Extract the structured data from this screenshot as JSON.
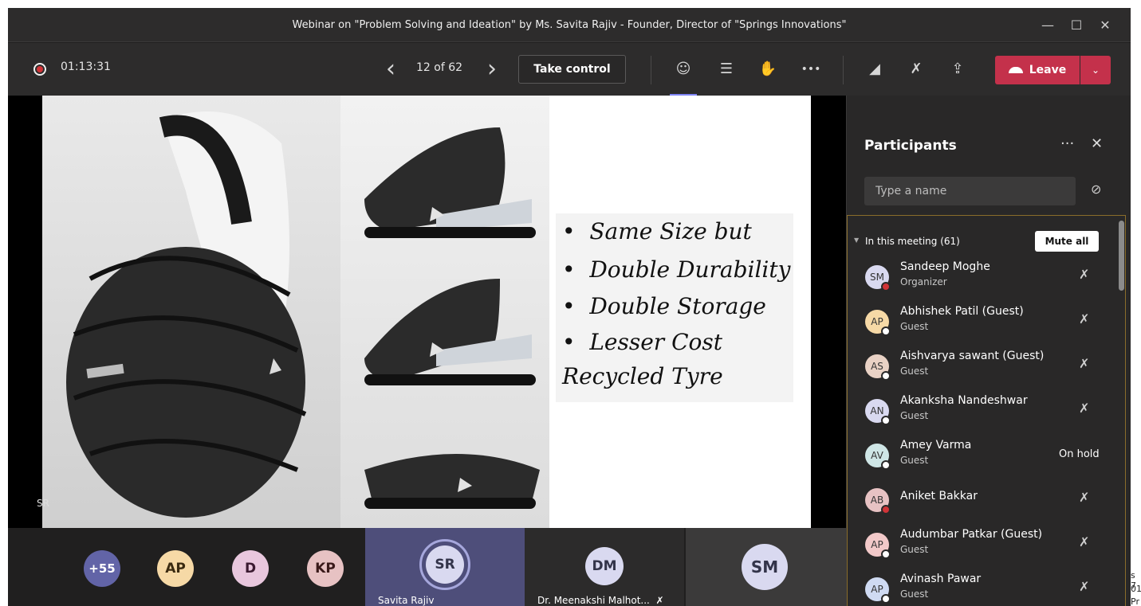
{
  "window": {
    "title": "Webinar on \"Problem Solving and Ideation\" by Ms. Savita Rajiv - Founder, Director of \"Springs Innovations\"",
    "controls": {
      "minimize": "—",
      "maximize": "☐",
      "close": "✕"
    }
  },
  "toolbar": {
    "timer": "01:13:31",
    "prev_icon": "‹",
    "slide_counter": "12 of 62",
    "next_icon": "›",
    "take_control": "Take control",
    "icons": {
      "participants": "☺",
      "chat": "☰",
      "raise_hand": "✋",
      "more": "•••",
      "camera_off": "◢",
      "mic_off": "✗",
      "share": "⇪"
    },
    "leave_label": "Leave",
    "leave_dropdown": "⌄",
    "accent": "#c4314b"
  },
  "slide": {
    "bullets": [
      "Same Size but",
      "Double Durability",
      "Double Storage",
      "Lesser Cost"
    ],
    "bullet_glyph": "•",
    "footer_line": "Recycled Tyre",
    "presenter_tag": "SR"
  },
  "strip": {
    "overflow_badge": "+55",
    "small_avatars": [
      {
        "initials": "AP",
        "color": "#f6d9a6"
      },
      {
        "initials": "D",
        "color": "#e8c7dd"
      },
      {
        "initials": "KP",
        "color": "#e7c2c3"
      }
    ],
    "tiles": [
      {
        "initials": "SR",
        "name": "Savita Rajiv"
      },
      {
        "initials": "DM",
        "name": "Dr. Meenakshi Malhot...",
        "muted_icon": "✗"
      },
      {
        "initials": "SM",
        "name": ""
      }
    ]
  },
  "participants": {
    "title": "Participants",
    "more_icon": "···",
    "close_icon": "✕",
    "search_placeholder": "Type a name",
    "link_icon": "⊘",
    "section_label": "In this meeting (61)",
    "mute_all": "Mute all",
    "list": [
      {
        "initials": "SM",
        "name": "Sandeep Moghe",
        "role": "Organizer",
        "status": "mic-off",
        "avatar": "#d9d9f0",
        "dot": "#d13438"
      },
      {
        "initials": "AP",
        "name": "Abhishek Patil (Guest)",
        "role": "Guest",
        "status": "mic-off",
        "avatar": "#f6d9a6",
        "dot": "#ffffff"
      },
      {
        "initials": "AS",
        "name": "Aishvarya sawant (Guest)",
        "role": "Guest",
        "status": "mic-off",
        "avatar": "#e9d2c5",
        "dot": "#ffffff"
      },
      {
        "initials": "AN",
        "name": "Akanksha Nandeshwar",
        "role": "Guest",
        "status": "mic-off",
        "avatar": "#d9d9f0",
        "dot": "#ffffff"
      },
      {
        "initials": "AV",
        "name": "Amey Varma",
        "role": "Guest",
        "status": "On hold",
        "avatar": "#cfe6e6",
        "dot": "#ffffff"
      },
      {
        "initials": "AB",
        "name": "Aniket Bakkar",
        "role": "",
        "status": "mic-off",
        "avatar": "#e7c2c3",
        "dot": "#d13438"
      },
      {
        "initials": "AP",
        "name": "Audumbar Patkar (Guest)",
        "role": "Guest",
        "status": "mic-off",
        "avatar": "#f2c9c9",
        "dot": "#ffffff"
      },
      {
        "initials": "AP",
        "name": "Avinash Pawar",
        "role": "Guest",
        "status": "mic-off",
        "avatar": "#cfdaf2",
        "dot": "#ffffff"
      }
    ],
    "mic_off_glyph": "✗"
  },
  "edge_fragments": [
    "s 7",
    "01",
    "Pr"
  ]
}
